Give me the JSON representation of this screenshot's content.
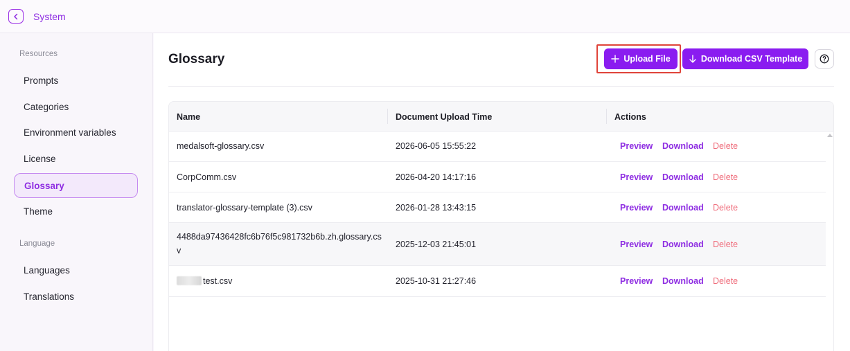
{
  "topbar": {
    "title": "System"
  },
  "sidebar": {
    "sections": [
      {
        "label": "Resources",
        "items": [
          "Prompts",
          "Categories",
          "Environment variables",
          "License",
          "Glossary",
          "Theme"
        ]
      },
      {
        "label": "Language",
        "items": [
          "Languages",
          "Translations"
        ]
      }
    ],
    "active": "Glossary"
  },
  "main": {
    "title": "Glossary",
    "upload_label": "Upload File",
    "download_template_label": "Download CSV Template",
    "help_icon": "question-circle-icon"
  },
  "table": {
    "columns": [
      "Name",
      "Document Upload Time",
      "Actions"
    ],
    "rows": [
      {
        "name": "medalsoft-glossary.csv",
        "time": "2026-06-05 15:55:22"
      },
      {
        "name": "CorpComm.csv",
        "time": "2026-04-20 14:17:16"
      },
      {
        "name": "translator-glossary-template (3).csv",
        "time": "2026-01-28 13:43:15"
      },
      {
        "name": "4488da97436428fc6b76f5c981732b6b.zh.glossary.csv",
        "time": "2025-12-03 21:45:01"
      },
      {
        "name": "test.csv",
        "time": "2025-10-31 21:27:46"
      }
    ],
    "actions": {
      "preview": "Preview",
      "download": "Download",
      "delete": "Delete"
    }
  },
  "colors": {
    "accent": "#8a1cf0",
    "delete": "#ef6b7a",
    "highlight": "#e0443a"
  }
}
